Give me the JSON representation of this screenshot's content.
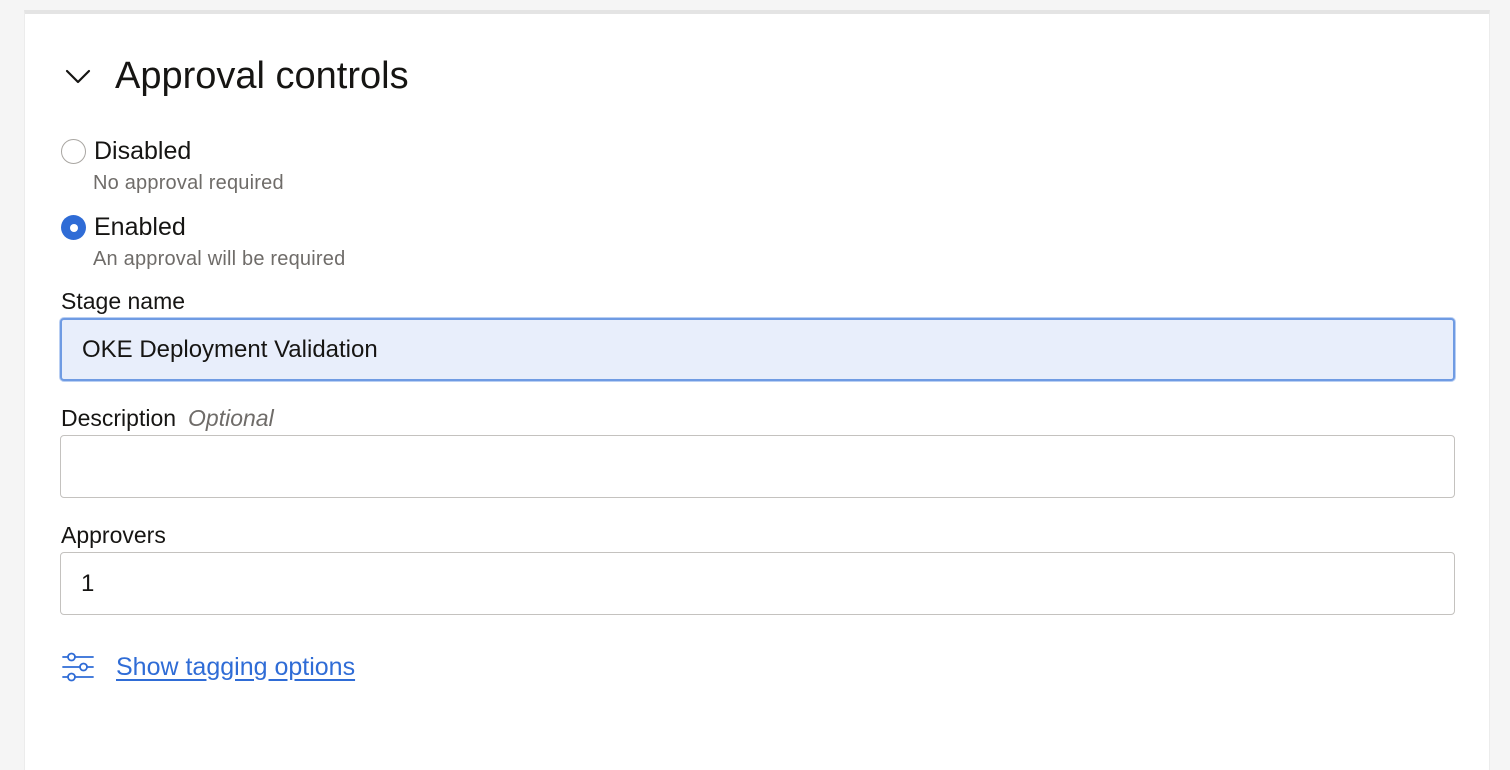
{
  "section": {
    "title": "Approval controls",
    "expanded": true
  },
  "approval_options": [
    {
      "label": "Disabled",
      "help": "No approval required",
      "selected": false
    },
    {
      "label": "Enabled",
      "help": "An approval will be required",
      "selected": true
    }
  ],
  "stage_name": {
    "label": "Stage name",
    "value": "OKE Deployment Validation"
  },
  "description": {
    "label": "Description",
    "optional_tag": "Optional",
    "value": ""
  },
  "approvers": {
    "label": "Approvers",
    "value": "1"
  },
  "tagging": {
    "link_label": "Show tagging options",
    "icon": "sliders-icon"
  },
  "colors": {
    "accent": "#2f6cd6",
    "focused_input_bg": "#e8eefb",
    "focused_input_border": "#6f9be3",
    "help_text": "#6f6c69"
  }
}
